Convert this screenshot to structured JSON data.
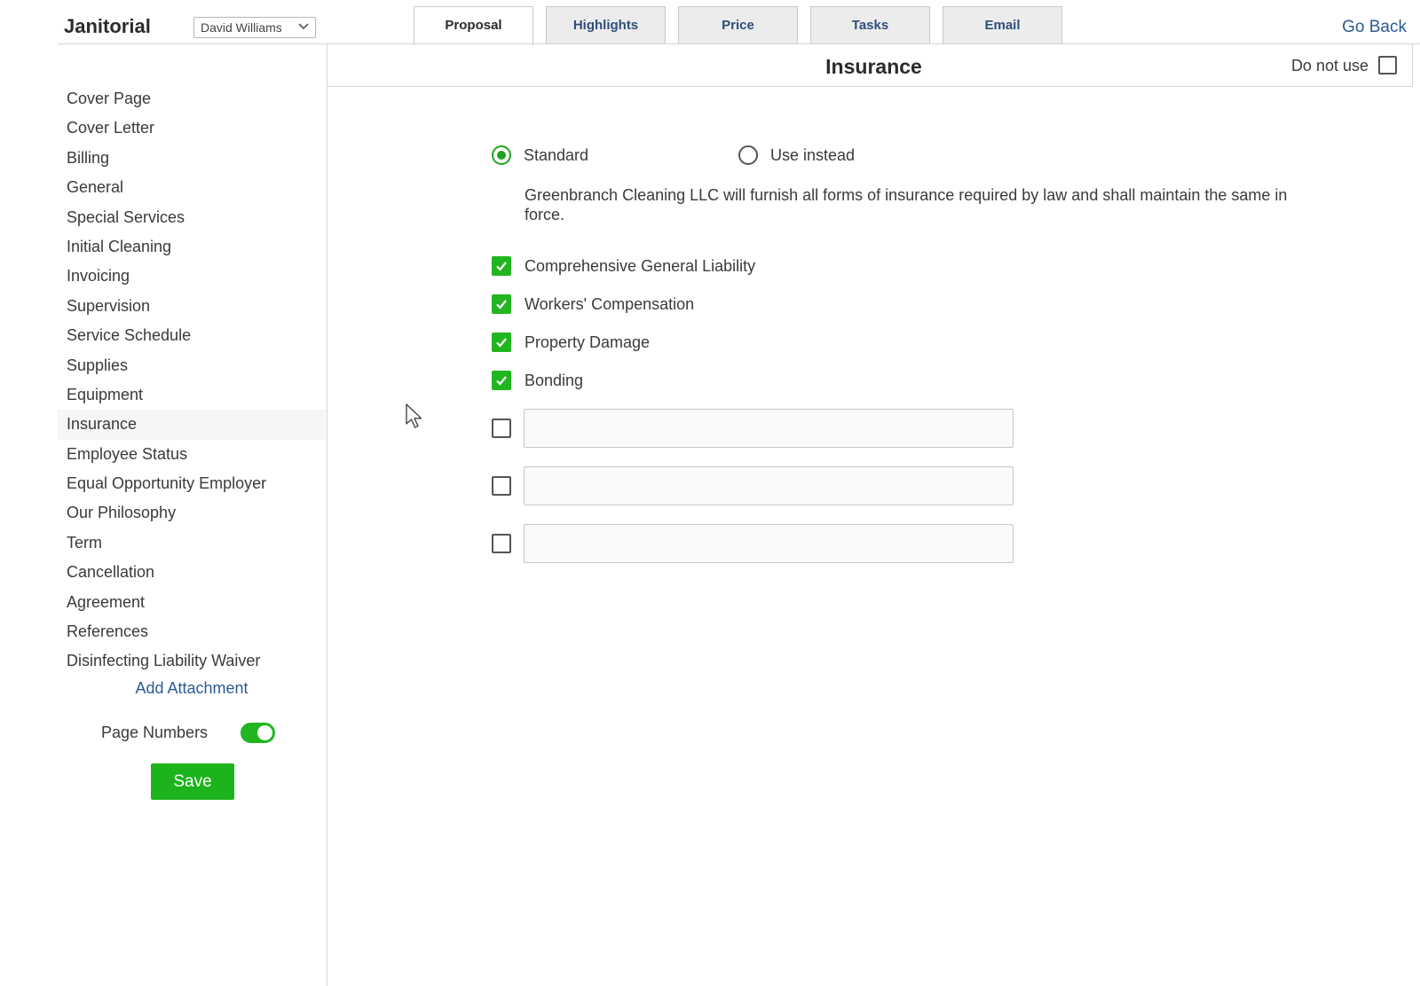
{
  "header": {
    "app_title": "Janitorial",
    "user_select": "David Williams",
    "tabs": [
      {
        "label": "Proposal",
        "active": true
      },
      {
        "label": "Highlights",
        "active": false
      },
      {
        "label": "Price",
        "active": false
      },
      {
        "label": "Tasks",
        "active": false
      },
      {
        "label": "Email",
        "active": false
      }
    ],
    "go_back": "Go Back"
  },
  "sidebar": {
    "items": [
      {
        "label": "Cover Page"
      },
      {
        "label": "Cover Letter"
      },
      {
        "label": "Billing"
      },
      {
        "label": "General"
      },
      {
        "label": "Special Services"
      },
      {
        "label": "Initial Cleaning"
      },
      {
        "label": "Invoicing"
      },
      {
        "label": "Supervision"
      },
      {
        "label": "Service Schedule"
      },
      {
        "label": "Supplies"
      },
      {
        "label": "Equipment"
      },
      {
        "label": "Insurance",
        "active": true
      },
      {
        "label": "Employee Status"
      },
      {
        "label": "Equal Opportunity Employer"
      },
      {
        "label": "Our Philosophy"
      },
      {
        "label": "Term"
      },
      {
        "label": "Cancellation"
      },
      {
        "label": "Agreement"
      },
      {
        "label": "References"
      },
      {
        "label": "Disinfecting Liability Waiver"
      }
    ],
    "add_attachment": "Add Attachment",
    "page_numbers_label": "Page Numbers",
    "page_numbers_on": true,
    "save_label": "Save"
  },
  "main": {
    "title": "Insurance",
    "do_not_use_label": "Do not use",
    "do_not_use_checked": false,
    "radio_standard": "Standard",
    "radio_use_instead": "Use instead",
    "selected_option": "Standard",
    "standard_text": "Greenbranch Cleaning LLC will furnish all forms of insurance required by law and shall maintain the same in force.",
    "coverages": [
      {
        "label": "Comprehensive General Liability",
        "checked": true
      },
      {
        "label": "Workers' Compensation",
        "checked": true
      },
      {
        "label": "Property Damage",
        "checked": true
      },
      {
        "label": "Bonding",
        "checked": true
      }
    ],
    "custom_fields": [
      {
        "value": "",
        "checked": false
      },
      {
        "value": "",
        "checked": false
      },
      {
        "value": "",
        "checked": false
      }
    ]
  },
  "colors": {
    "accent_green": "#21b520",
    "link_blue": "#2c5a93"
  }
}
